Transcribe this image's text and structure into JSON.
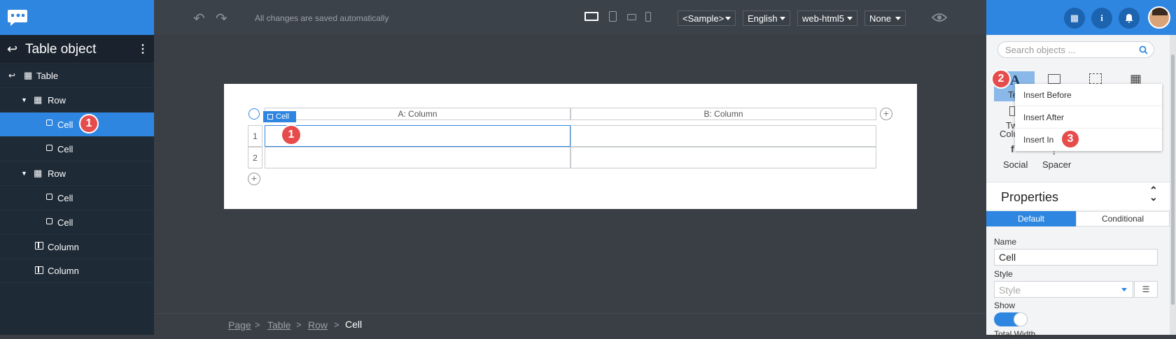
{
  "toolbar": {
    "save_status": "All changes are saved automatically",
    "dropdowns": [
      "<Sample>",
      "English",
      "web-html5",
      "None"
    ]
  },
  "left_panel": {
    "title": "Table object",
    "tree": [
      {
        "label": "Table",
        "icon": "table-icon"
      },
      {
        "label": "Row",
        "icon": "row-grid-icon"
      },
      {
        "label": "Cell",
        "icon": "cell-square-icon",
        "selected": true,
        "badge": "1"
      },
      {
        "label": "Cell",
        "icon": "cell-square-icon"
      },
      {
        "label": "Row",
        "icon": "row-grid-icon"
      },
      {
        "label": "Cell",
        "icon": "cell-square-icon"
      },
      {
        "label": "Cell",
        "icon": "cell-square-icon"
      },
      {
        "label": "Column",
        "icon": "column-icon"
      },
      {
        "label": "Column",
        "icon": "column-icon"
      }
    ]
  },
  "canvas": {
    "col_a": "A: Column",
    "col_b": "B: Column",
    "row_1": "1",
    "row_2": "2",
    "cell_tag": "Cell",
    "badge": "1"
  },
  "breadcrumb": [
    "Page",
    "Table",
    "Row",
    "Cell"
  ],
  "right_panel": {
    "search_placeholder": "Search objects ...",
    "objects": [
      "Te",
      "Tw",
      "Colu",
      "Social",
      "Spacer"
    ],
    "badge_2": "2",
    "badge_3": "3",
    "context_menu": [
      "Insert Before",
      "Insert After",
      "Insert In"
    ],
    "properties_title": "Properties",
    "tabs": [
      "Default",
      "Conditional"
    ],
    "name_label": "Name",
    "name_value": "Cell",
    "style_label": "Style",
    "style_placeholder": "Style",
    "show_label": "Show",
    "next_label": "Total Width",
    "show_on": true
  },
  "colors": {
    "accent": "#2f86e0",
    "badge": "#e74c4c",
    "sidebar": "#1e2a36"
  }
}
